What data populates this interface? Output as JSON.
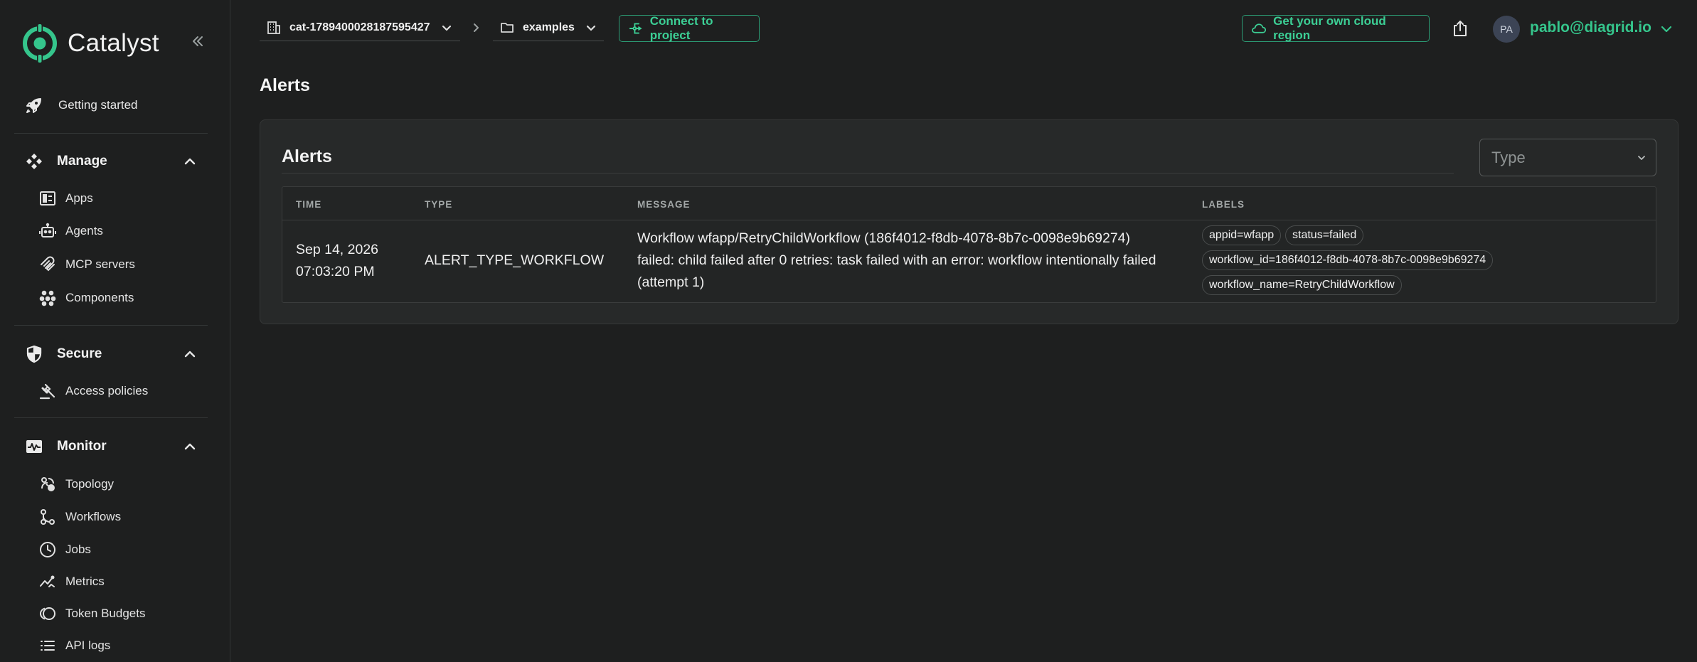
{
  "app": {
    "name": "Catalyst",
    "colors": {
      "accent": "#35c58c",
      "background": "#1e1f1f",
      "card": "#272929"
    }
  },
  "sidebar": {
    "top_item": {
      "label": "Getting started",
      "icon": "rocket-icon"
    },
    "sections": [
      {
        "label": "Manage",
        "icon": "manage-icon",
        "expanded": true,
        "items": [
          {
            "label": "Apps",
            "icon": "apps-icon"
          },
          {
            "label": "Agents",
            "icon": "agent-icon"
          },
          {
            "label": "MCP servers",
            "icon": "mcp-icon"
          },
          {
            "label": "Components",
            "icon": "components-icon"
          }
        ]
      },
      {
        "label": "Secure",
        "icon": "shield-icon",
        "expanded": true,
        "items": [
          {
            "label": "Access policies",
            "icon": "gavel-icon"
          }
        ]
      },
      {
        "label": "Monitor",
        "icon": "monitor-icon",
        "expanded": true,
        "items": [
          {
            "label": "Topology",
            "icon": "topology-icon"
          },
          {
            "label": "Workflows",
            "icon": "workflow-icon"
          },
          {
            "label": "Jobs",
            "icon": "clock-icon"
          },
          {
            "label": "Metrics",
            "icon": "metrics-icon"
          },
          {
            "label": "Token Budgets",
            "icon": "token-icon"
          },
          {
            "label": "API logs",
            "icon": "list-icon"
          }
        ]
      }
    ]
  },
  "topbar": {
    "org": {
      "label": "cat-1789400028187595427",
      "icon": "building-icon"
    },
    "project": {
      "label": "examples",
      "icon": "folder-icon"
    },
    "connect_button": "Connect to project",
    "cloud_button": "Get your own cloud region",
    "user": {
      "initials": "PA",
      "email": "pablo@diagrid.io"
    }
  },
  "page": {
    "title": "Alerts",
    "card": {
      "title": "Alerts",
      "filter": {
        "placeholder": "Type"
      },
      "table": {
        "columns": [
          "TIME",
          "TYPE",
          "MESSAGE",
          "LABELS"
        ],
        "rows": [
          {
            "time_date": "Sep 14, 2026",
            "time_clock": "07:03:20 PM",
            "type": "ALERT_TYPE_WORKFLOW",
            "message_lines": [
              "Workflow wfapp/RetryChildWorkflow (186f4012-f8db-4078-8b7c-0098e9b69274)",
              "failed: child failed after 0 retries: task failed with an error: workflow intentionally failed",
              "(attempt 1)"
            ],
            "labels": [
              "appid=wfapp",
              "status=failed",
              "workflow_id=186f4012-f8db-4078-8b7c-0098e9b69274",
              "workflow_name=RetryChildWorkflow"
            ]
          }
        ]
      }
    }
  }
}
